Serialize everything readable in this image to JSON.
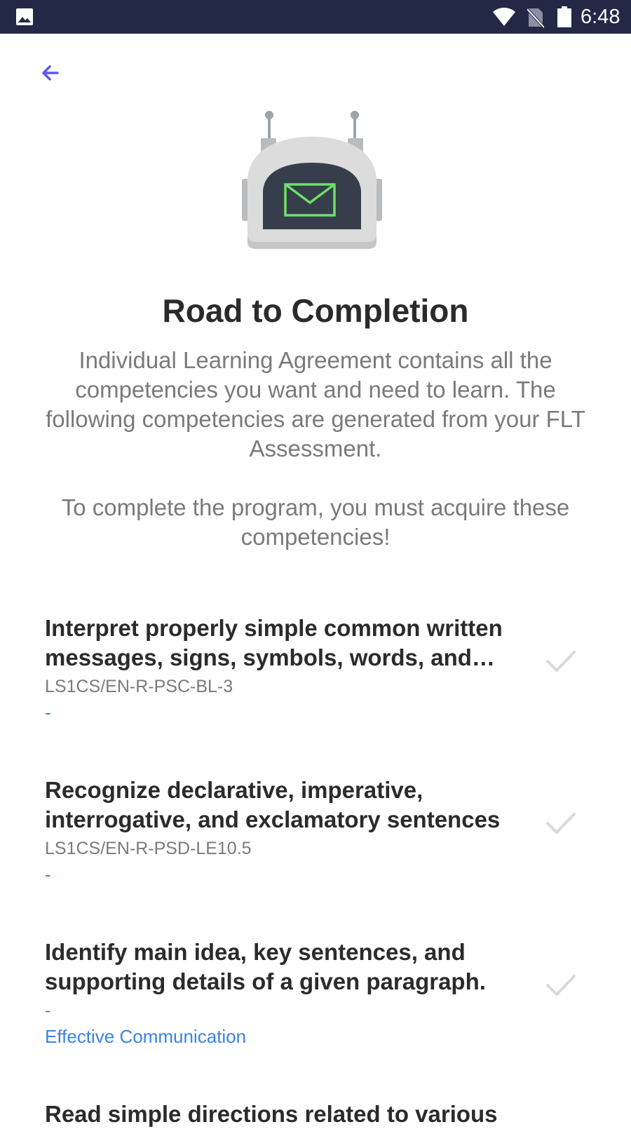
{
  "status_bar": {
    "time": "6:48"
  },
  "header": {
    "back_icon": "arrow-left-icon",
    "accent_color": "#5B5BE8"
  },
  "hero": {
    "image": "robot-mail-icon",
    "title": "Road to Completion",
    "paragraph_1": "Individual Learning Agreement contains all the competencies you want and need to learn. The following competencies are generated from your FLT Assessment.",
    "paragraph_2": "To complete the program, you must acquire these competencies!"
  },
  "competencies": [
    {
      "name": "Interpret properly simple common written messages, signs, symbols, words, and phrases",
      "code": "LS1CS/EN-R-PSC-BL-3",
      "category": "-"
    },
    {
      "name": "Recognize declarative, imperative, interrogative, and exclamatory sentences",
      "code": "LS1CS/EN-R-PSD-LE10.5",
      "category": "-"
    },
    {
      "name": "Identify main idea, key sentences, and supporting details of a given paragraph.",
      "code": "-",
      "category": "Effective Communication"
    },
    {
      "name": "Read simple directions related to various",
      "code": "",
      "category": ""
    }
  ],
  "colors": {
    "status_bar_bg": "#222845",
    "title_text": "#2B2B2B",
    "body_text": "#7A7A7A",
    "link_blue": "#3B82E6",
    "check_gray": "#D9D9D9"
  }
}
